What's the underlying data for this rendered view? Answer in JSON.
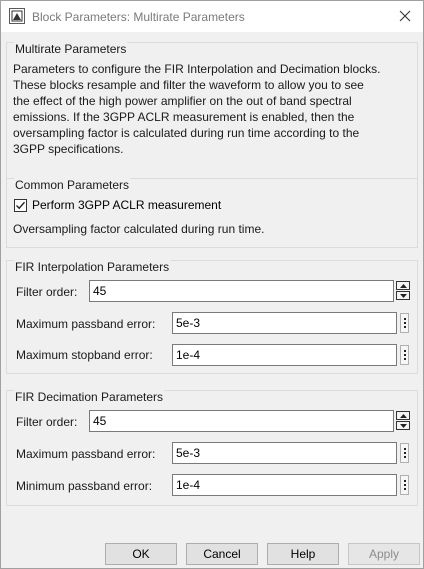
{
  "window": {
    "title": "Block Parameters: Multirate Parameters"
  },
  "multirate": {
    "title": "Multirate Parameters",
    "description_lines": [
      "Parameters to configure the FIR Interpolation and Decimation blocks.",
      "These blocks resample and filter the waveform to allow you to see",
      "the effect of the high power amplifier on the out of band spectral",
      "emissions. If the 3GPP ACLR measurement is enabled, then the",
      "oversampling factor is calculated during run time according to the",
      "3GPP specifications."
    ]
  },
  "common": {
    "title": "Common Parameters",
    "aclr_label": "Perform 3GPP ACLR measurement",
    "aclr_checked": true,
    "oversampling_note": "Oversampling factor calculated during run time."
  },
  "interpolation": {
    "title": "FIR Interpolation Parameters",
    "filter_order_label": "Filter order:",
    "filter_order_value": "45",
    "passband_label": "Maximum passband error:",
    "passband_value": "5e-3",
    "stopband_label": "Maximum stopband error:",
    "stopband_value": "1e-4"
  },
  "decimation": {
    "title": "FIR Decimation Parameters",
    "filter_order_label": "Filter order:",
    "filter_order_value": "45",
    "passband_label": "Maximum passband error:",
    "passband_value": "5e-3",
    "min_passband_label": "Minimum passband error:",
    "min_passband_value": "1e-4"
  },
  "buttons": {
    "ok": "OK",
    "cancel": "Cancel",
    "help": "Help",
    "apply": "Apply"
  },
  "icons": {
    "app": "simulink-block-icon",
    "close": "close-icon"
  }
}
